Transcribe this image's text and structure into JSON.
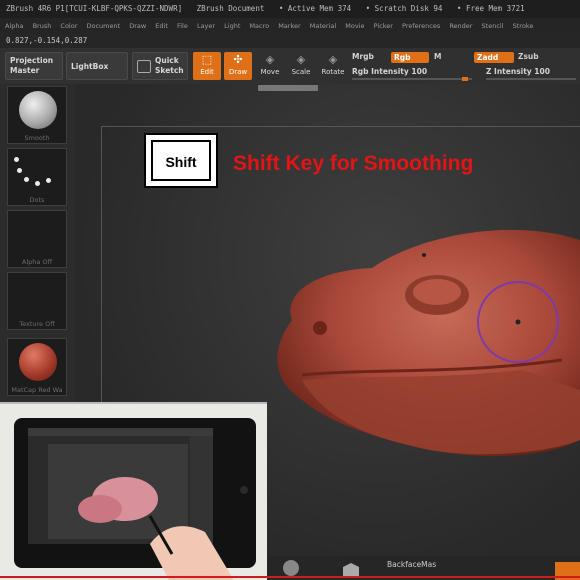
{
  "titlebar": {
    "items": [
      "ZBrush 4R6 P1[TCUI-KLBF-QPKS-QZZI-NDWR]",
      "ZBrush Document",
      "• Active Mem 374",
      "• Scratch Disk 94",
      "• Free Mem 3721"
    ]
  },
  "menu": [
    "Alpha",
    "Brush",
    "Color",
    "Document",
    "Draw",
    "Edit",
    "File",
    "Layer",
    "Light",
    "Macro",
    "Marker",
    "Material",
    "Movie",
    "Picker",
    "Preferences",
    "Render",
    "Stencil",
    "Stroke"
  ],
  "coords": "0.827,-0.154,0.287",
  "toolbar": {
    "projection_line1": "Projection",
    "projection_line2": "Master",
    "lightbox": "LightBox",
    "quick_line1": "Quick",
    "quick_line2": "Sketch",
    "edit": "Edit",
    "draw": "Draw",
    "move": "Move",
    "scale": "Scale",
    "rotate": "Rotate",
    "mrgb": "Mrgb",
    "rgb": "Rgb",
    "m": "M",
    "zadd": "Zadd",
    "zsub": "Zsub",
    "rgb_intensity": "Rgb Intensity 100",
    "z_intensity": "Z Intensity 100"
  },
  "tray": {
    "items": [
      "Smooth",
      "Dots",
      "Alpha Off",
      "Texture Off",
      "MatCap Red Wa"
    ]
  },
  "overlay": {
    "key_label": "Shift",
    "caption": "Shift Key for Smoothing"
  },
  "bottom": {
    "backface": "BackfaceMas"
  },
  "colors": {
    "accent": "#e07018",
    "caption": "#e31414",
    "clay": "#a9483a"
  }
}
